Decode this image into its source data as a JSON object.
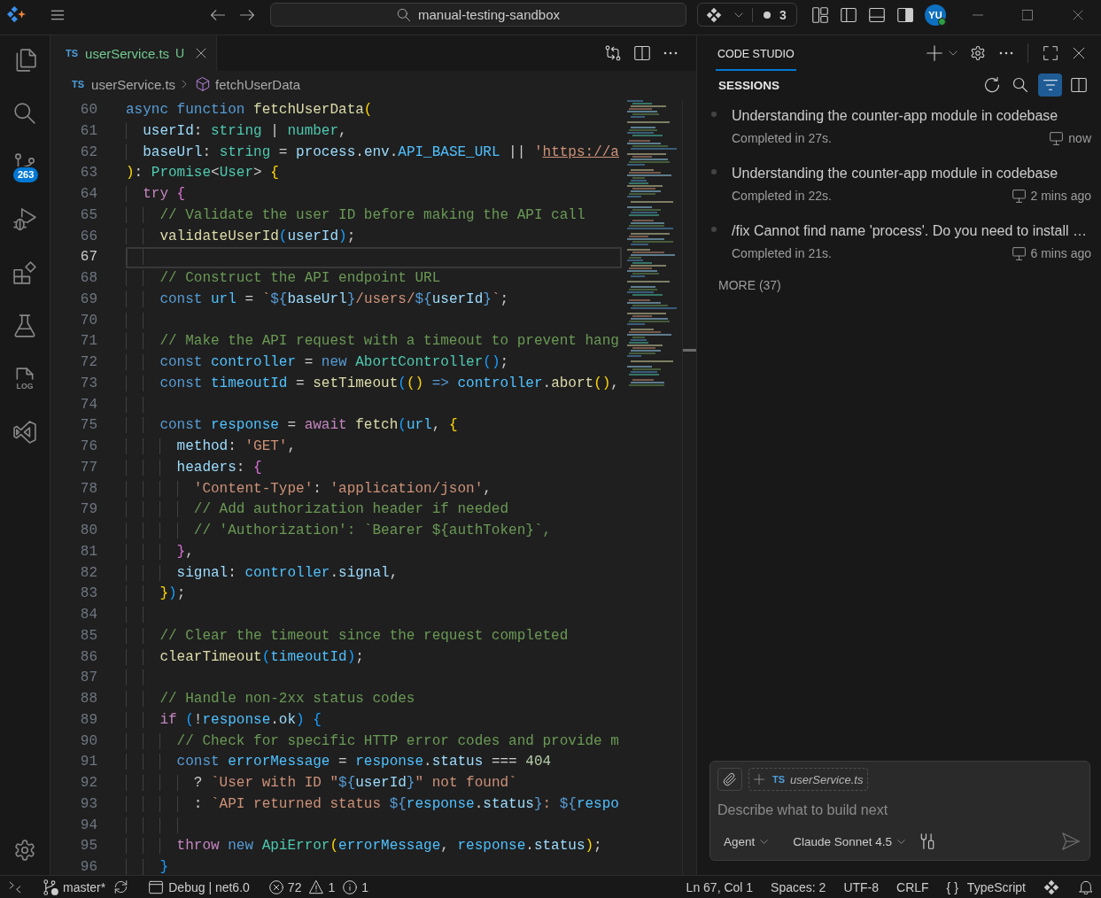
{
  "title_bar": {
    "search": "manual-testing-sandbox",
    "agent_count": "3",
    "avatar": "YU"
  },
  "activity_bar": {
    "source_control_badge": "263",
    "log_label": "LOG"
  },
  "editor": {
    "tabs": [
      {
        "file_type": "TS",
        "label": "userService.ts",
        "git_status": "U",
        "selected": true
      }
    ],
    "breadcrumb": {
      "file_type": "TS",
      "file": "userService.ts",
      "symbol": "fetchUserData"
    },
    "lines": [
      {
        "number": "60",
        "current": false,
        "tokens": [
          {
            "kind": "keyword",
            "text": "async function "
          },
          {
            "kind": "function",
            "text": "fetchUserData"
          },
          {
            "kind": "bracket1",
            "text": "("
          }
        ]
      },
      {
        "number": "61",
        "current": false,
        "tokens": [
          {
            "kind": "variable",
            "text": "  userId"
          },
          {
            "kind": "plain",
            "text": ": "
          },
          {
            "kind": "type",
            "text": "string"
          },
          {
            "kind": "plain",
            "text": " | "
          },
          {
            "kind": "type",
            "text": "number"
          },
          {
            "kind": "plain",
            "text": ","
          }
        ]
      },
      {
        "number": "62",
        "current": false,
        "tokens": [
          {
            "kind": "variable",
            "text": "  baseUrl"
          },
          {
            "kind": "plain",
            "text": ": "
          },
          {
            "kind": "type",
            "text": "string"
          },
          {
            "kind": "plain",
            "text": " = "
          },
          {
            "kind": "variable",
            "text": "process"
          },
          {
            "kind": "plain",
            "text": "."
          },
          {
            "kind": "variable",
            "text": "env"
          },
          {
            "kind": "plain",
            "text": "."
          },
          {
            "kind": "constant",
            "text": "API_BASE_URL"
          },
          {
            "kind": "plain",
            "text": " || "
          },
          {
            "kind": "string",
            "text": "'"
          },
          {
            "kind": "link",
            "text": "https://a"
          }
        ]
      },
      {
        "number": "63",
        "current": false,
        "tokens": [
          {
            "kind": "bracket1",
            "text": ")"
          },
          {
            "kind": "plain",
            "text": ": "
          },
          {
            "kind": "type",
            "text": "Promise"
          },
          {
            "kind": "plain",
            "text": "<"
          },
          {
            "kind": "type",
            "text": "User"
          },
          {
            "kind": "plain",
            "text": "> "
          },
          {
            "kind": "bracket1",
            "text": "{"
          }
        ]
      },
      {
        "number": "64",
        "current": false,
        "tokens": [
          {
            "kind": "control",
            "text": "  try "
          },
          {
            "kind": "bracket2",
            "text": "{"
          }
        ]
      },
      {
        "number": "65",
        "current": false,
        "tokens": [
          {
            "kind": "comment",
            "text": "    // Validate the user ID before making the API call"
          }
        ]
      },
      {
        "number": "66",
        "current": false,
        "tokens": [
          {
            "kind": "function",
            "text": "    validateUserId"
          },
          {
            "kind": "bracket3",
            "text": "("
          },
          {
            "kind": "variable",
            "text": "userId"
          },
          {
            "kind": "bracket3",
            "text": ")"
          },
          {
            "kind": "plain",
            "text": ";"
          }
        ]
      },
      {
        "number": "67",
        "current": true
      },
      {
        "number": "68",
        "current": false,
        "tokens": [
          {
            "kind": "comment",
            "text": "    // Construct the API endpoint URL"
          }
        ]
      },
      {
        "number": "69",
        "current": false,
        "tokens": [
          {
            "kind": "keyword",
            "text": "    const "
          },
          {
            "kind": "constant",
            "text": "url"
          },
          {
            "kind": "plain",
            "text": " = "
          },
          {
            "kind": "string",
            "text": "`"
          },
          {
            "kind": "keyword",
            "text": "${"
          },
          {
            "kind": "variable",
            "text": "baseUrl"
          },
          {
            "kind": "keyword",
            "text": "}"
          },
          {
            "kind": "string",
            "text": "/users/"
          },
          {
            "kind": "keyword",
            "text": "${"
          },
          {
            "kind": "variable",
            "text": "userId"
          },
          {
            "kind": "keyword",
            "text": "}"
          },
          {
            "kind": "string",
            "text": "`"
          },
          {
            "kind": "plain",
            "text": ";"
          }
        ]
      },
      {
        "number": "70",
        "current": false
      },
      {
        "number": "71",
        "current": false,
        "tokens": [
          {
            "kind": "comment",
            "text": "    // Make the API request with a timeout to prevent hang"
          }
        ]
      },
      {
        "number": "72",
        "current": false,
        "tokens": [
          {
            "kind": "keyword",
            "text": "    const "
          },
          {
            "kind": "constant",
            "text": "controller"
          },
          {
            "kind": "plain",
            "text": " = "
          },
          {
            "kind": "keyword",
            "text": "new "
          },
          {
            "kind": "type",
            "text": "AbortController"
          },
          {
            "kind": "bracket3",
            "text": "()"
          },
          {
            "kind": "plain",
            "text": ";"
          }
        ]
      },
      {
        "number": "73",
        "current": false,
        "tokens": [
          {
            "kind": "keyword",
            "text": "    const "
          },
          {
            "kind": "constant",
            "text": "timeoutId"
          },
          {
            "kind": "plain",
            "text": " = "
          },
          {
            "kind": "function",
            "text": "setTimeout"
          },
          {
            "kind": "bracket3",
            "text": "("
          },
          {
            "kind": "bracket1",
            "text": "() "
          },
          {
            "kind": "keyword",
            "text": "=> "
          },
          {
            "kind": "constant",
            "text": "controller"
          },
          {
            "kind": "plain",
            "text": "."
          },
          {
            "kind": "function",
            "text": "abort"
          },
          {
            "kind": "bracket1",
            "text": "()"
          },
          {
            "kind": "plain",
            "text": ","
          }
        ]
      },
      {
        "number": "74",
        "current": false
      },
      {
        "number": "75",
        "current": false,
        "tokens": [
          {
            "kind": "keyword",
            "text": "    const "
          },
          {
            "kind": "constant",
            "text": "response"
          },
          {
            "kind": "plain",
            "text": " = "
          },
          {
            "kind": "control",
            "text": "await "
          },
          {
            "kind": "function",
            "text": "fetch"
          },
          {
            "kind": "bracket3",
            "text": "("
          },
          {
            "kind": "constant",
            "text": "url"
          },
          {
            "kind": "plain",
            "text": ", "
          },
          {
            "kind": "bracket1",
            "text": "{"
          }
        ]
      },
      {
        "number": "76",
        "current": false,
        "tokens": [
          {
            "kind": "variable",
            "text": "      method"
          },
          {
            "kind": "plain",
            "text": ": "
          },
          {
            "kind": "string",
            "text": "'GET'"
          },
          {
            "kind": "plain",
            "text": ","
          }
        ]
      },
      {
        "number": "77",
        "current": false,
        "tokens": [
          {
            "kind": "variable",
            "text": "      headers"
          },
          {
            "kind": "plain",
            "text": ": "
          },
          {
            "kind": "bracket2",
            "text": "{"
          }
        ]
      },
      {
        "number": "78",
        "current": false,
        "tokens": [
          {
            "kind": "string",
            "text": "        'Content-Type'"
          },
          {
            "kind": "plain",
            "text": ": "
          },
          {
            "kind": "string",
            "text": "'application/json'"
          },
          {
            "kind": "plain",
            "text": ","
          }
        ]
      },
      {
        "number": "79",
        "current": false,
        "tokens": [
          {
            "kind": "comment",
            "text": "        // Add authorization header if needed"
          }
        ]
      },
      {
        "number": "80",
        "current": false,
        "tokens": [
          {
            "kind": "comment",
            "text": "        // 'Authorization': `Bearer ${authToken}`,"
          }
        ]
      },
      {
        "number": "81",
        "current": false,
        "tokens": [
          {
            "kind": "bracket2",
            "text": "      }"
          },
          {
            "kind": "plain",
            "text": ","
          }
        ]
      },
      {
        "number": "82",
        "current": false,
        "tokens": [
          {
            "kind": "variable",
            "text": "      signal"
          },
          {
            "kind": "plain",
            "text": ": "
          },
          {
            "kind": "constant",
            "text": "controller"
          },
          {
            "kind": "plain",
            "text": "."
          },
          {
            "kind": "variable",
            "text": "signal"
          },
          {
            "kind": "plain",
            "text": ","
          }
        ]
      },
      {
        "number": "83",
        "current": false,
        "tokens": [
          {
            "kind": "bracket1",
            "text": "    }"
          },
          {
            "kind": "bracket3",
            "text": ")"
          },
          {
            "kind": "plain",
            "text": ";"
          }
        ]
      },
      {
        "number": "84",
        "current": false
      },
      {
        "number": "85",
        "current": false,
        "tokens": [
          {
            "kind": "comment",
            "text": "    // Clear the timeout since the request completed"
          }
        ]
      },
      {
        "number": "86",
        "current": false,
        "tokens": [
          {
            "kind": "function",
            "text": "    clearTimeout"
          },
          {
            "kind": "bracket3",
            "text": "("
          },
          {
            "kind": "constant",
            "text": "timeoutId"
          },
          {
            "kind": "bracket3",
            "text": ")"
          },
          {
            "kind": "plain",
            "text": ";"
          }
        ]
      },
      {
        "number": "87",
        "current": false
      },
      {
        "number": "88",
        "current": false,
        "tokens": [
          {
            "kind": "comment",
            "text": "    // Handle non-2xx status codes"
          }
        ]
      },
      {
        "number": "89",
        "current": false,
        "tokens": [
          {
            "kind": "control",
            "text": "    if "
          },
          {
            "kind": "bracket3",
            "text": "("
          },
          {
            "kind": "plain",
            "text": "!"
          },
          {
            "kind": "constant",
            "text": "response"
          },
          {
            "kind": "plain",
            "text": "."
          },
          {
            "kind": "variable",
            "text": "ok"
          },
          {
            "kind": "bracket3",
            "text": ") {"
          }
        ]
      },
      {
        "number": "90",
        "current": false,
        "tokens": [
          {
            "kind": "comment",
            "text": "      // Check for specific HTTP error codes and provide m"
          }
        ]
      },
      {
        "number": "91",
        "current": false,
        "tokens": [
          {
            "kind": "keyword",
            "text": "      const "
          },
          {
            "kind": "constant",
            "text": "errorMessage"
          },
          {
            "kind": "plain",
            "text": " = "
          },
          {
            "kind": "constant",
            "text": "response"
          },
          {
            "kind": "plain",
            "text": "."
          },
          {
            "kind": "variable",
            "text": "status"
          },
          {
            "kind": "plain",
            "text": " === "
          },
          {
            "kind": "number",
            "text": "404"
          }
        ]
      },
      {
        "number": "92",
        "current": false,
        "tokens": [
          {
            "kind": "plain",
            "text": "        ? "
          },
          {
            "kind": "string",
            "text": "`User with ID \""
          },
          {
            "kind": "keyword",
            "text": "${"
          },
          {
            "kind": "variable",
            "text": "userId"
          },
          {
            "kind": "keyword",
            "text": "}"
          },
          {
            "kind": "string",
            "text": "\" not found`"
          }
        ]
      },
      {
        "number": "93",
        "current": false,
        "tokens": [
          {
            "kind": "plain",
            "text": "        : "
          },
          {
            "kind": "string",
            "text": "`API returned status "
          },
          {
            "kind": "keyword",
            "text": "${"
          },
          {
            "kind": "constant",
            "text": "response"
          },
          {
            "kind": "plain",
            "text": "."
          },
          {
            "kind": "variable",
            "text": "status"
          },
          {
            "kind": "keyword",
            "text": "}"
          },
          {
            "kind": "string",
            "text": ": "
          },
          {
            "kind": "keyword",
            "text": "${"
          },
          {
            "kind": "constant",
            "text": "respo"
          }
        ]
      },
      {
        "number": "94",
        "current": false
      },
      {
        "number": "95",
        "current": false,
        "tokens": [
          {
            "kind": "control",
            "text": "      throw "
          },
          {
            "kind": "keyword",
            "text": "new "
          },
          {
            "kind": "type",
            "text": "ApiError"
          },
          {
            "kind": "bracket1",
            "text": "("
          },
          {
            "kind": "constant",
            "text": "errorMessage"
          },
          {
            "kind": "plain",
            "text": ", "
          },
          {
            "kind": "constant",
            "text": "response"
          },
          {
            "kind": "plain",
            "text": "."
          },
          {
            "kind": "variable",
            "text": "status"
          },
          {
            "kind": "bracket1",
            "text": ")"
          },
          {
            "kind": "plain",
            "text": ";"
          }
        ]
      },
      {
        "number": "96",
        "current": false,
        "tokens": [
          {
            "kind": "bracket3",
            "text": "    }"
          }
        ]
      }
    ]
  },
  "panel": {
    "tabs": [
      {
        "label": "CODE STUDIO",
        "selected": true
      }
    ],
    "section": "SESSIONS",
    "filter_active": true,
    "sessions": [
      {
        "title": "Understanding the counter-app module in codebase",
        "status": "Completed in 27s.",
        "time": "now"
      },
      {
        "title": "Understanding the counter-app module in codebase",
        "status": "Completed in 22s.",
        "time": "2 mins ago"
      },
      {
        "title": "/fix Cannot find name 'process'. Do you need to install …",
        "status": "Completed in 21s.",
        "time": "6 mins ago"
      }
    ],
    "more": "MORE (37)",
    "chat": {
      "context_type": "TS",
      "context_file": "userService.ts",
      "placeholder": "Describe what to build next",
      "mode": "Agent",
      "model": "Claude Sonnet 4.5",
      "send_disabled": true
    }
  },
  "status_bar": {
    "branch": "master*",
    "config": "Debug | net6.0",
    "errors": "72",
    "warnings": "1",
    "infos": "1",
    "position": "Ln 67, Col 1",
    "indentation": "Spaces: 2",
    "encoding": "UTF-8",
    "line_ending": "CRLF",
    "language_glyph": "{ }",
    "language": "TypeScript"
  }
}
